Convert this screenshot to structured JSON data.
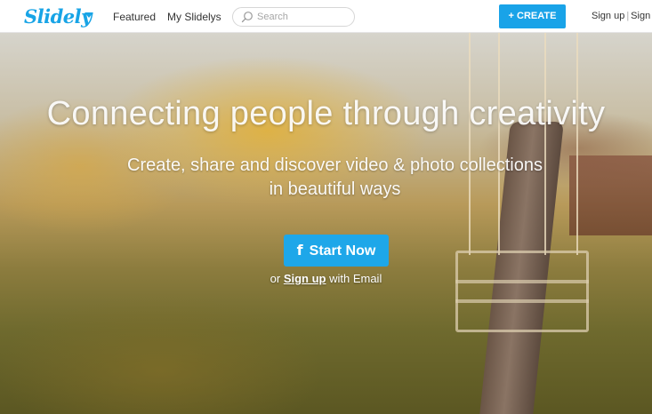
{
  "header": {
    "logo": "Slidely",
    "logo_menu_icon": "chevron-down-icon",
    "nav": [
      {
        "label": "Featured"
      },
      {
        "label": "My Slidelys"
      }
    ],
    "search": {
      "placeholder": "Search",
      "icon": "search-icon"
    },
    "create_label": "+ CREATE",
    "signup_label": "Sign up",
    "signin_label": "Sign in"
  },
  "hero": {
    "title": "Connecting people through creativity",
    "subtitle_line1": "Create, share and discover video & photo collections",
    "subtitle_line2": "in beautiful ways",
    "start_icon": "f",
    "start_label": "Start Now",
    "email_prefix": "or ",
    "email_link": "Sign up",
    "email_suffix": " with Email"
  },
  "colors": {
    "brand": "#18a4e6",
    "button": "#1ea7e9"
  }
}
